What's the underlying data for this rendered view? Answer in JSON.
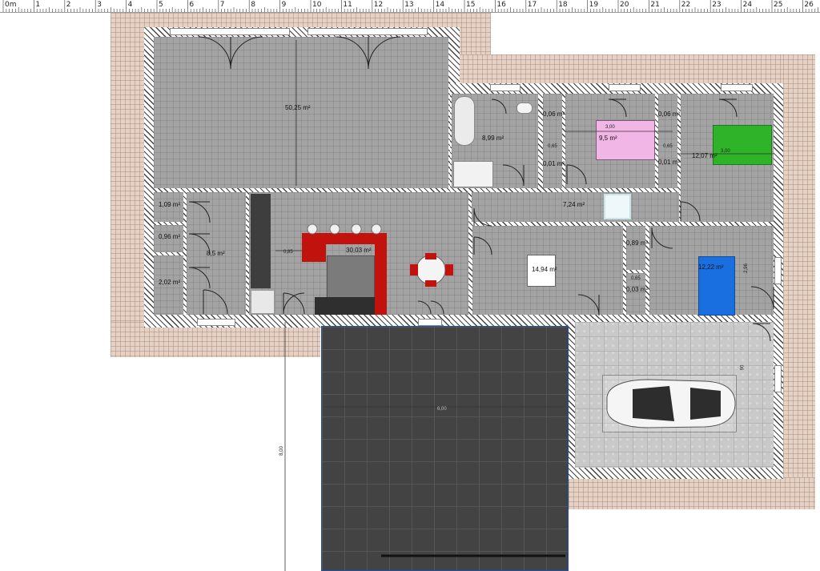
{
  "ruler": {
    "labels": [
      "0m",
      "1",
      "2",
      "3",
      "4",
      "5",
      "6",
      "7",
      "8",
      "9",
      "10",
      "11",
      "12",
      "13",
      "14",
      "15",
      "16",
      "17",
      "18",
      "19",
      "20",
      "21",
      "22",
      "23",
      "24",
      "25",
      "26"
    ]
  },
  "rooms": {
    "garage_room": "50,25 m²",
    "bathroom": "8,99 m²",
    "wc_1": "0,06 m²",
    "wc_2": "0,01 m²",
    "bedroom_pink": "9,5 m²",
    "closet_a": "0,06 m²",
    "closet_b": "0,01 m²",
    "bedroom_green": "12,07 m²",
    "hallway": "7,24 m²",
    "storage_1": "1,09 m²",
    "storage_2": "0,96 m²",
    "storage_3": "2,02 m²",
    "entrance": "8,5 m²",
    "kitchen_living": "30,03 m²",
    "office": "14,94 m²",
    "closet_c": "0,89 m²",
    "closet_d": "0,03 m²",
    "bedroom_blue": "12,22 m²"
  },
  "dimensions": {
    "bed_width_pink": "3,00",
    "bed_width_green": "3,00",
    "kitchen_depth": "0,85",
    "small_65_a": "0,65",
    "small_65_b": "0,65",
    "small_65_c": "0,65",
    "driveway_width": "6,00",
    "plot_height": "8,00",
    "room_height_right": "2,96",
    "garage_depth": "90"
  },
  "colors": {
    "kitchen_counter": "#c1120e",
    "bed_pink": "#f2b6e6",
    "bed_green": "#2fb329",
    "bed_blue": "#1a6fe0",
    "wall_border": "#444444",
    "driveway": "#434343"
  }
}
